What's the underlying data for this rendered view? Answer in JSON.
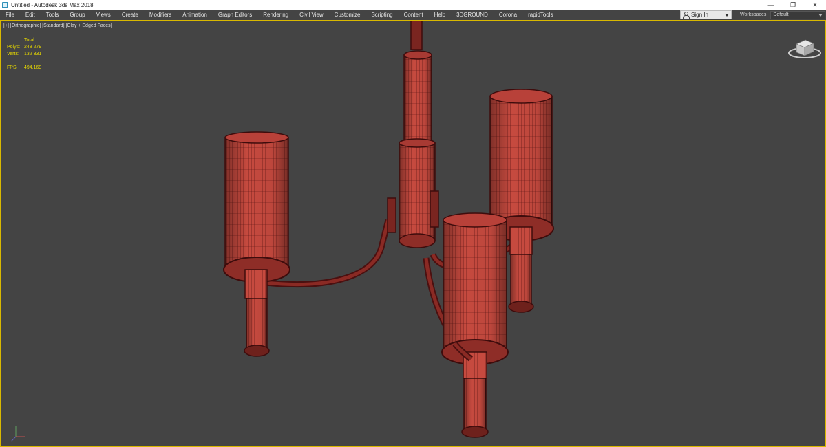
{
  "window": {
    "title": "Untitled - Autodesk 3ds Max 2018",
    "minimize": "—",
    "restore": "❐",
    "close": "✕"
  },
  "menu": [
    "File",
    "Edit",
    "Tools",
    "Group",
    "Views",
    "Create",
    "Modifiers",
    "Animation",
    "Graph Editors",
    "Rendering",
    "Civil View",
    "Customize",
    "Scripting",
    "Content",
    "Help",
    "3DGROUND",
    "Corona",
    "rapidTools"
  ],
  "signin": {
    "label": "Sign In",
    "icon": "user-icon"
  },
  "workspaces": {
    "label": "Workspaces:",
    "value": "Default"
  },
  "viewport": {
    "label": "[+] [Orthographic] [Standard] [Clay + Edged Faces]",
    "stats": {
      "header": "Total",
      "polys_label": "Polys:",
      "polys": "248 279",
      "verts_label": "Verts:",
      "verts": "132 331",
      "fps_label": "FPS:",
      "fps": "494,169"
    }
  },
  "colors": {
    "viewport_bg": "#444444",
    "model_fill": "#c94a40",
    "wire": "#5a1212",
    "stats_text": "#e7d800",
    "active_border": "#d8b800"
  }
}
